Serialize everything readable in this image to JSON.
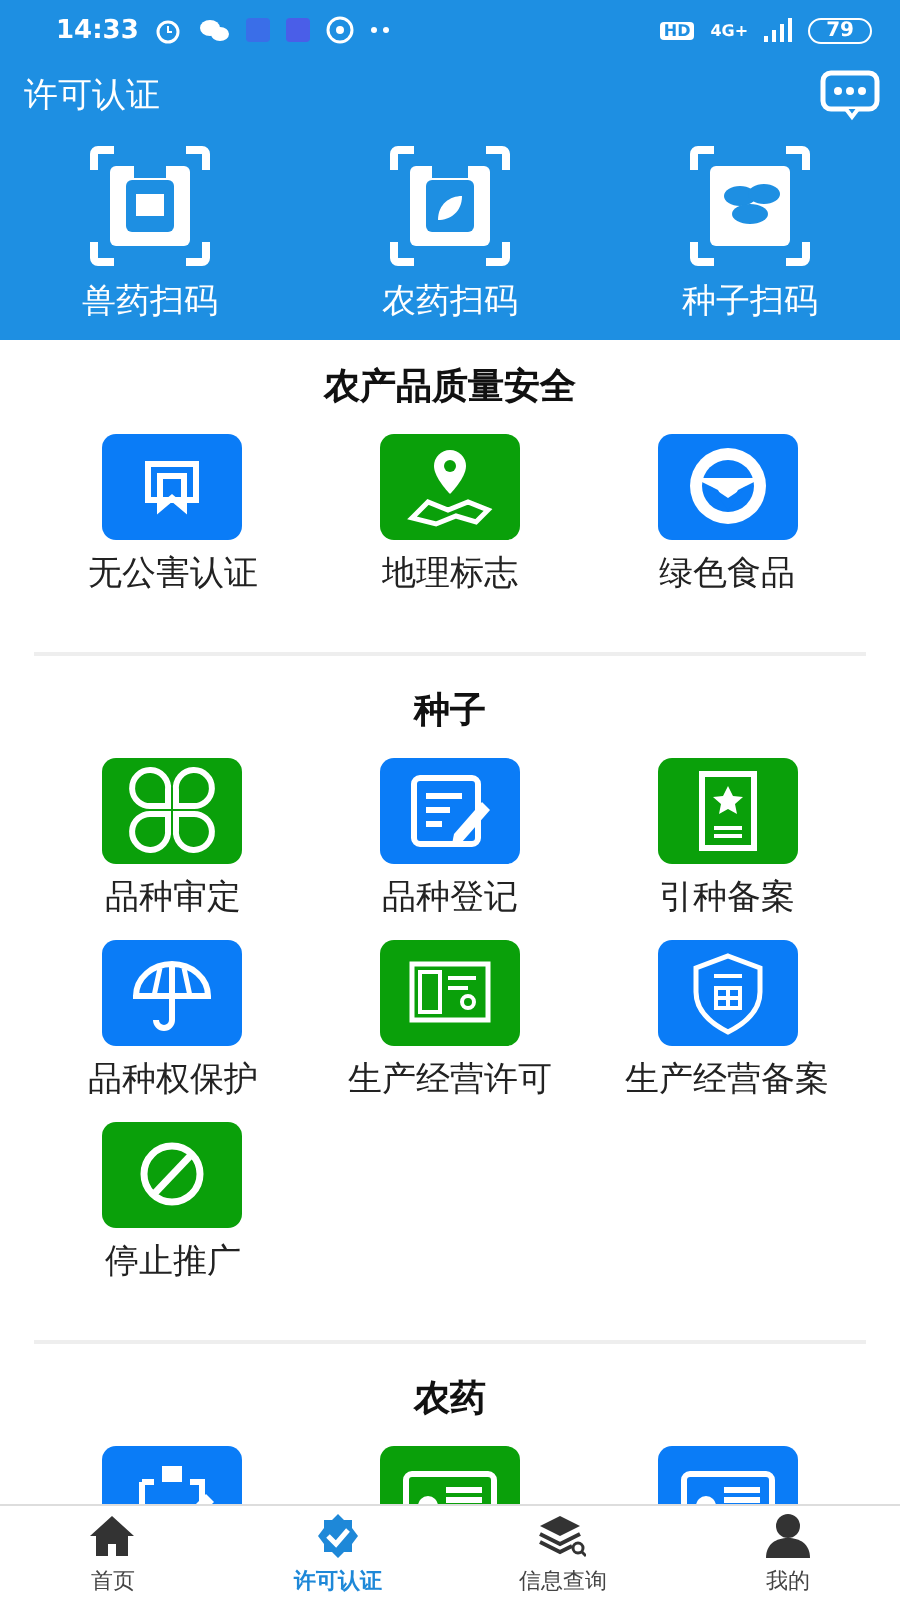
{
  "status_bar": {
    "time": "14:33",
    "network": "4G+",
    "hd": "HD",
    "battery": "79"
  },
  "header": {
    "title": "许可认证"
  },
  "scan_buttons": [
    {
      "label": "兽药扫码",
      "kind": "bottle"
    },
    {
      "label": "农药扫码",
      "kind": "jar"
    },
    {
      "label": "种子扫码",
      "kind": "beans"
    }
  ],
  "sections": [
    {
      "title": "农产品质量安全",
      "items": [
        {
          "label": "无公害认证",
          "kind": "ribbon",
          "color": "#0a7cf7"
        },
        {
          "label": "地理标志",
          "kind": "pin",
          "color": "#0aa00a"
        },
        {
          "label": "绿色食品",
          "kind": "emblem",
          "color": "#0a7cf7"
        }
      ]
    },
    {
      "title": "种子",
      "items": [
        {
          "label": "品种审定",
          "kind": "clover",
          "color": "#0aa00a"
        },
        {
          "label": "品种登记",
          "kind": "edit",
          "color": "#0a7cf7"
        },
        {
          "label": "引种备案",
          "kind": "star",
          "color": "#0aa00a"
        },
        {
          "label": "品种权保护",
          "kind": "umbrella",
          "color": "#0a7cf7"
        },
        {
          "label": "生产经营许可",
          "kind": "license",
          "color": "#0aa00a"
        },
        {
          "label": "生产经营备案",
          "kind": "shield",
          "color": "#0a7cf7"
        },
        {
          "label": "停止推广",
          "kind": "forbid",
          "color": "#0aa00a"
        }
      ]
    },
    {
      "title": "农药",
      "items": [
        {
          "kind": "clipboard",
          "color": "#0a7cf7"
        },
        {
          "kind": "card",
          "color": "#0aa00a"
        },
        {
          "kind": "card",
          "color": "#0a7cf7"
        }
      ]
    }
  ],
  "tabs": [
    {
      "label": "首页",
      "kind": "home",
      "selected": false
    },
    {
      "label": "许可认证",
      "kind": "badge",
      "selected": true
    },
    {
      "label": "信息查询",
      "kind": "layers",
      "selected": false
    },
    {
      "label": "我的",
      "kind": "person",
      "selected": false
    }
  ]
}
